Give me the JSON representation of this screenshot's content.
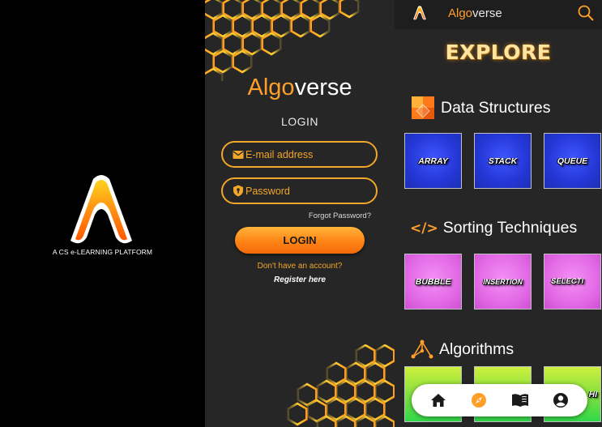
{
  "splash": {
    "tagline": "A CS e-LEARNING PLATFORM"
  },
  "login": {
    "brand_part1": "Algo",
    "brand_part2": "verse",
    "title": "LOGIN",
    "email_placeholder": "E-mail address",
    "password_placeholder": "Password",
    "forgot_password": "Forgot Password?",
    "login_button": "LOGIN",
    "no_account": "Don't have an account?",
    "register": "Register here"
  },
  "explore": {
    "header": {
      "brand_part1": "Algo",
      "brand_part2": "verse"
    },
    "title": "EXPLORE",
    "sections": [
      {
        "title": "Data Structures",
        "cards": [
          "ARRAY",
          "STACK",
          "QUEUE"
        ]
      },
      {
        "title": "Sorting Techniques",
        "icon_text": "</>",
        "cards": [
          "BUBBLE",
          "INSERTION",
          "SELECTI"
        ]
      },
      {
        "title": "Algorithms",
        "cards": [
          "",
          "",
          "HI"
        ]
      }
    ],
    "bottom_nav": [
      "home-icon",
      "compass-icon",
      "book-icon",
      "account-icon"
    ]
  },
  "colors": {
    "accent_orange": "#ff9f2a",
    "field_border": "#f2a62a",
    "panel_bg": "#262626",
    "card_blue": "#2437d6",
    "card_pink": "#e36be6",
    "card_green": "#86e040"
  }
}
